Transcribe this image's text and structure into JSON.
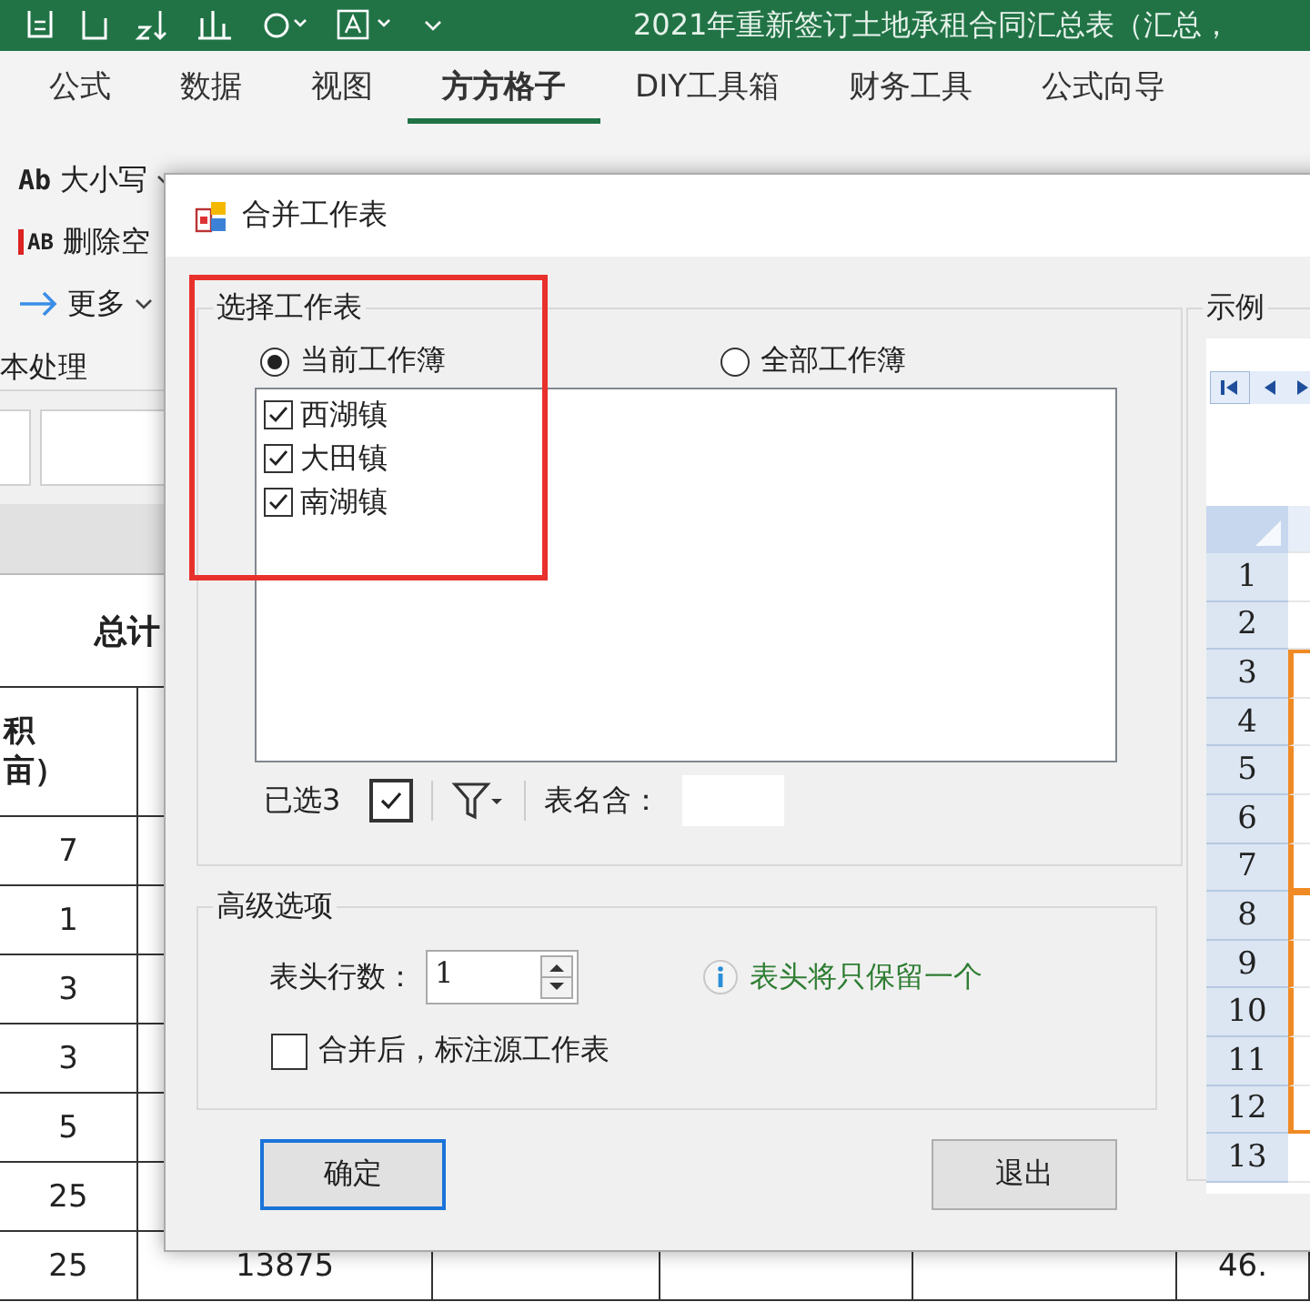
{
  "excel": {
    "title": "2021年重新签订土地承租合同汇总表（汇总，",
    "tabs": [
      {
        "label": "公式",
        "selected": false
      },
      {
        "label": "数据",
        "selected": false
      },
      {
        "label": "视图",
        "selected": false
      },
      {
        "label": "方方格子",
        "selected": true
      },
      {
        "label": "DIY工具箱",
        "selected": false
      },
      {
        "label": "财务工具",
        "selected": false
      },
      {
        "label": "公式向导",
        "selected": false
      }
    ],
    "ribbon": {
      "items": [
        {
          "kind": "case",
          "glyph": "Ab",
          "label": "大小写",
          "caret": true
        },
        {
          "kind": "delete",
          "glyph": "AB",
          "label": "删除空",
          "caret": false
        },
        {
          "kind": "more",
          "label": "更多",
          "caret": true
        }
      ],
      "group_label": "本处理"
    },
    "sheet": {
      "title": "总计",
      "rows": [
        {
          "column_a_lines": [
            "积",
            "亩）"
          ]
        },
        {
          "column_a": "7"
        },
        {
          "column_a": "1"
        },
        {
          "column_a": "3"
        },
        {
          "column_a": "3"
        },
        {
          "column_a": "5"
        },
        {
          "column_a": "25"
        },
        {
          "column_a": "25",
          "column_b": "13875",
          "column_f": "46."
        }
      ]
    }
  },
  "dialog": {
    "title": "合并工作表",
    "select_group": {
      "legend": "选择工作表",
      "scopes": [
        {
          "label": "当前工作簿",
          "selected": true
        },
        {
          "label": "全部工作簿",
          "selected": false
        }
      ],
      "sheets": [
        {
          "label": "西湖镇",
          "checked": true
        },
        {
          "label": "大田镇",
          "checked": true
        },
        {
          "label": "南湖镇",
          "checked": true
        }
      ],
      "selected_count": "已选3",
      "select_all": true,
      "name_filter_label": "表名含："
    },
    "advanced": {
      "legend": "高级选项",
      "header_rows_label": "表头行数：",
      "header_rows": "1",
      "note": "表头将只保留一个",
      "mark_source": {
        "label": "合并后，标注源工作表",
        "checked": false
      }
    },
    "buttons": [
      {
        "label": "确定",
        "focused": true
      },
      {
        "label": "退出",
        "focused": false
      }
    ],
    "preview": {
      "legend": "示例",
      "rows": [
        {
          "number": "1",
          "kind": "plain"
        },
        {
          "number": "2",
          "kind": "plain"
        },
        {
          "number": "3",
          "kind": "first"
        },
        {
          "number": "4",
          "kind": "first"
        },
        {
          "number": "5",
          "kind": "first"
        },
        {
          "number": "6",
          "kind": "first"
        },
        {
          "number": "7",
          "kind": "first"
        },
        {
          "number": "8",
          "kind": "second"
        },
        {
          "number": "9",
          "kind": "second"
        },
        {
          "number": "10",
          "kind": "second"
        },
        {
          "number": "11",
          "kind": "second"
        },
        {
          "number": "12",
          "kind": "second"
        },
        {
          "number": "13",
          "kind": "plain"
        }
      ]
    }
  }
}
